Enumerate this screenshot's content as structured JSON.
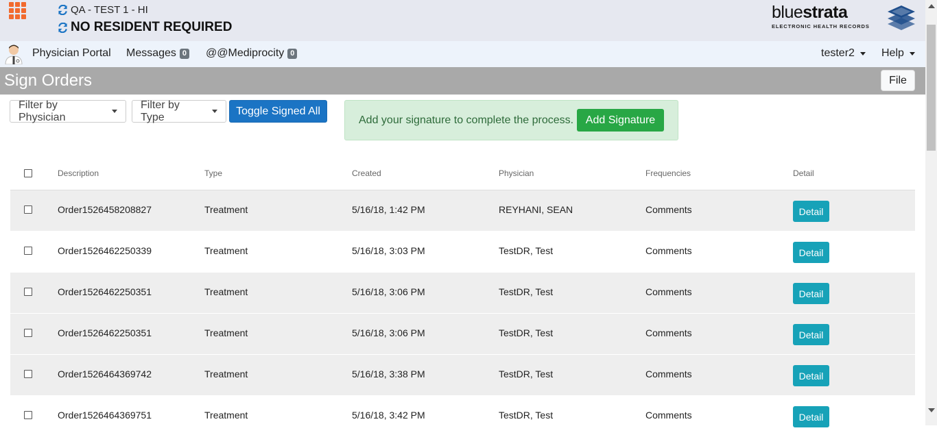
{
  "header": {
    "facility": "QA - TEST 1 - HI",
    "resident": "NO RESIDENT REQUIRED",
    "logo_thin": "blue",
    "logo_bold": "strata",
    "logo_tagline": "ELECTRONIC HEALTH RECORDS"
  },
  "nav": {
    "portal": "Physician Portal",
    "messages": "Messages",
    "messages_count": "0",
    "mediprocity": "@@Mediprocity",
    "mediprocity_count": "0",
    "user": "tester2",
    "help": "Help"
  },
  "page": {
    "title": "Sign Orders",
    "file_button": "File"
  },
  "filters": {
    "physician": "Filter by Physician",
    "type": "Filter by Type",
    "toggle": "Toggle Signed All"
  },
  "alert": {
    "text": "Add your signature to complete the process.",
    "button": "Add Signature"
  },
  "table": {
    "headers": [
      "Description",
      "Type",
      "Created",
      "Physician",
      "Frequencies",
      "Detail"
    ],
    "rows": [
      {
        "description": "Order1526458208827",
        "type": "Treatment",
        "created": "5/16/18, 1:42 PM",
        "physician": "REYHANI, SEAN",
        "frequencies": "Comments",
        "detail": "Detail"
      },
      {
        "description": "Order1526462250339",
        "type": "Treatment",
        "created": "5/16/18, 3:03 PM",
        "physician": "TestDR, Test",
        "frequencies": "Comments",
        "detail": "Detail"
      },
      {
        "description": "Order1526462250351",
        "type": "Treatment",
        "created": "5/16/18, 3:06 PM",
        "physician": "TestDR, Test",
        "frequencies": "Comments",
        "detail": "Detail"
      },
      {
        "description": "Order1526462250351",
        "type": "Treatment",
        "created": "5/16/18, 3:06 PM",
        "physician": "TestDR, Test",
        "frequencies": "Comments",
        "detail": "Detail"
      },
      {
        "description": "Order1526464369742",
        "type": "Treatment",
        "created": "5/16/18, 3:38 PM",
        "physician": "TestDR, Test",
        "frequencies": "Comments",
        "detail": "Detail"
      },
      {
        "description": "Order1526464369751",
        "type": "Treatment",
        "created": "5/16/18, 3:42 PM",
        "physician": "TestDR, Test",
        "frequencies": "Comments",
        "detail": "Detail"
      }
    ]
  },
  "colors": {
    "apps_icon": "#f26a2e",
    "primary": "#1b74c4",
    "success": "#28a745",
    "info": "#17a2b8",
    "title_bar": "#a9a9a9"
  }
}
